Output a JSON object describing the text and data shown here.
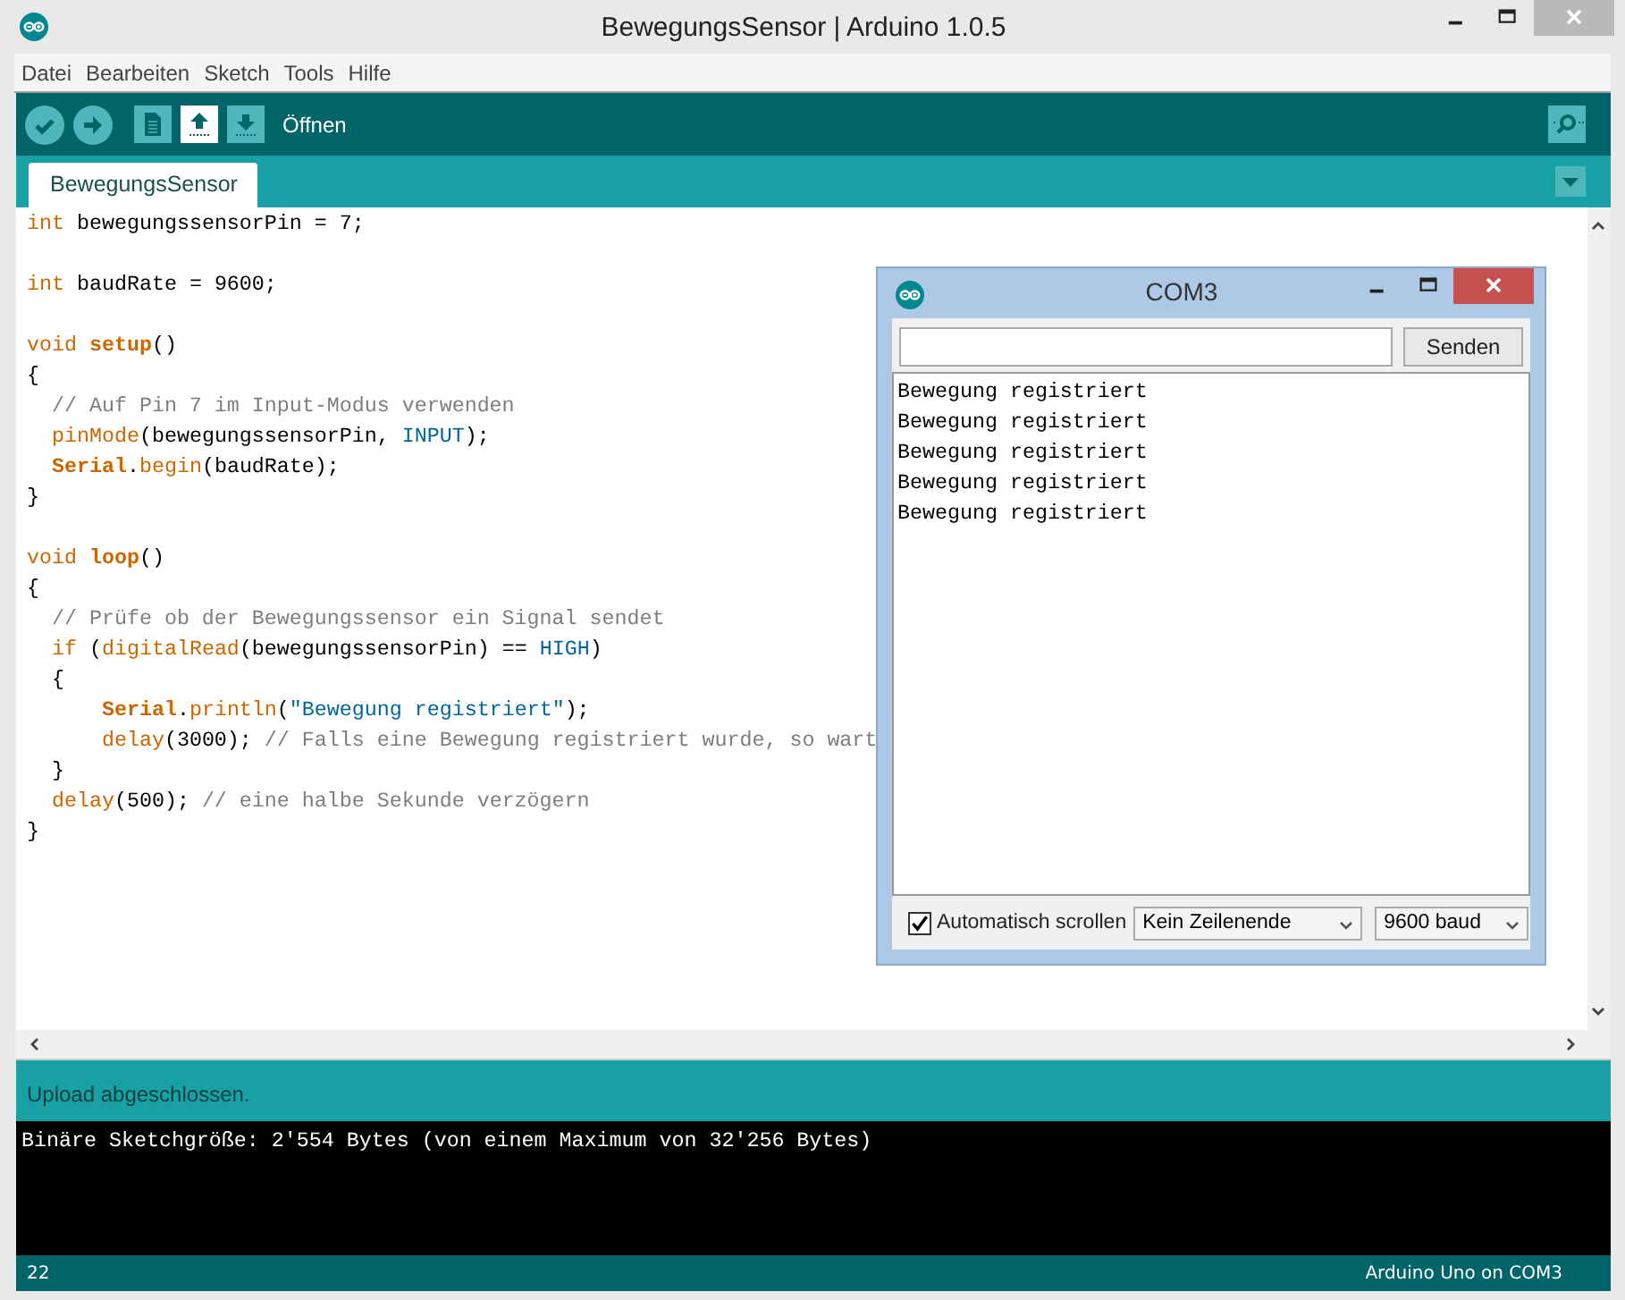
{
  "window": {
    "title": "BewegungsSensor | Arduino 1.0.5"
  },
  "menu": [
    "Datei",
    "Bearbeiten",
    "Sketch",
    "Tools",
    "Hilfe"
  ],
  "toolbar": {
    "buttons": [
      {
        "kind": "verify",
        "selected": false
      },
      {
        "kind": "upload",
        "selected": false
      },
      {
        "kind": "new",
        "selected": false
      },
      {
        "kind": "open",
        "selected": true
      },
      {
        "kind": "save",
        "selected": false
      }
    ],
    "hint": "Öffnen"
  },
  "tabs": [
    {
      "label": "BewegungsSensor",
      "selected": true
    }
  ],
  "editor": {
    "lines": [
      {
        "kind": "code",
        "tokens": [
          {
            "kind": "keyword",
            "text": "int"
          },
          {
            "kind": "plain",
            "text": " bewegungssensorPin = 7;"
          }
        ]
      },
      {
        "kind": "blank"
      },
      {
        "kind": "code",
        "tokens": [
          {
            "kind": "keyword",
            "text": "int"
          },
          {
            "kind": "plain",
            "text": " baudRate = 9600;"
          }
        ]
      },
      {
        "kind": "blank"
      },
      {
        "kind": "code",
        "tokens": [
          {
            "kind": "keyword",
            "text": "void "
          },
          {
            "kind": "bold",
            "text": "setup"
          },
          {
            "kind": "plain",
            "text": "()"
          }
        ]
      },
      {
        "kind": "code",
        "tokens": [
          {
            "kind": "plain",
            "text": "{"
          }
        ]
      },
      {
        "kind": "code",
        "tokens": [
          {
            "kind": "comment",
            "text": "  // Auf Pin 7 im Input-Modus verwenden"
          }
        ]
      },
      {
        "kind": "code",
        "tokens": [
          {
            "kind": "function",
            "text": "  pinMode"
          },
          {
            "kind": "plain",
            "text": "(bewegungssensorPin, "
          },
          {
            "kind": "constant",
            "text": "INPUT"
          },
          {
            "kind": "plain",
            "text": ");"
          }
        ]
      },
      {
        "kind": "code",
        "tokens": [
          {
            "kind": "bold",
            "text": "  Serial"
          },
          {
            "kind": "plain",
            "text": "."
          },
          {
            "kind": "function",
            "text": "begin"
          },
          {
            "kind": "plain",
            "text": "(baudRate);"
          }
        ]
      },
      {
        "kind": "code",
        "tokens": [
          {
            "kind": "plain",
            "text": "}"
          }
        ]
      },
      {
        "kind": "blank"
      },
      {
        "kind": "code",
        "tokens": [
          {
            "kind": "keyword",
            "text": "void "
          },
          {
            "kind": "bold",
            "text": "loop"
          },
          {
            "kind": "plain",
            "text": "()"
          }
        ]
      },
      {
        "kind": "code",
        "tokens": [
          {
            "kind": "plain",
            "text": "{"
          }
        ]
      },
      {
        "kind": "code",
        "tokens": [
          {
            "kind": "comment",
            "text": "  // Prüfe ob der Bewegungssensor ein Signal sendet"
          }
        ]
      },
      {
        "kind": "code",
        "tokens": [
          {
            "kind": "keyword",
            "text": "  if"
          },
          {
            "kind": "plain",
            "text": " ("
          },
          {
            "kind": "function",
            "text": "digitalRead"
          },
          {
            "kind": "plain",
            "text": "(bewegungssensorPin) == "
          },
          {
            "kind": "constant",
            "text": "HIGH"
          },
          {
            "kind": "plain",
            "text": ")"
          }
        ]
      },
      {
        "kind": "code",
        "tokens": [
          {
            "kind": "plain",
            "text": "  {"
          }
        ]
      },
      {
        "kind": "code",
        "tokens": [
          {
            "kind": "bold",
            "text": "      Serial"
          },
          {
            "kind": "plain",
            "text": "."
          },
          {
            "kind": "function",
            "text": "println"
          },
          {
            "kind": "plain",
            "text": "("
          },
          {
            "kind": "string",
            "text": "\"Bewegung registriert\""
          },
          {
            "kind": "plain",
            "text": ");"
          }
        ]
      },
      {
        "kind": "code",
        "tokens": [
          {
            "kind": "function",
            "text": "      delay"
          },
          {
            "kind": "plain",
            "text": "(3000); "
          },
          {
            "kind": "comment",
            "text": "// Falls eine Bewegung registriert wurde, so wart"
          }
        ]
      },
      {
        "kind": "code",
        "tokens": [
          {
            "kind": "plain",
            "text": "  }"
          }
        ]
      },
      {
        "kind": "code",
        "tokens": [
          {
            "kind": "function",
            "text": "  delay"
          },
          {
            "kind": "plain",
            "text": "(500); "
          },
          {
            "kind": "comment",
            "text": "// eine halbe Sekunde verzögern"
          }
        ]
      },
      {
        "kind": "code",
        "tokens": [
          {
            "kind": "plain",
            "text": "}"
          }
        ]
      }
    ]
  },
  "serial_monitor": {
    "title": "COM3",
    "send": "Senden",
    "output": [
      "Bewegung registriert",
      "Bewegung registriert",
      "Bewegung registriert",
      "Bewegung registriert",
      "Bewegung registriert"
    ],
    "autoscroll": {
      "label": "Automatisch scrollen",
      "checked": true
    },
    "line_ending": "Kein Zeilenende",
    "baud": "9600 baud"
  },
  "status": {
    "message": "Upload abgeschlossen."
  },
  "console": [
    "Binäre Sketchgröße: 2'554 Bytes (von einem Maximum von 32'256 Bytes)"
  ],
  "footer": {
    "line": "22",
    "board": "Arduino Uno on COM3"
  }
}
